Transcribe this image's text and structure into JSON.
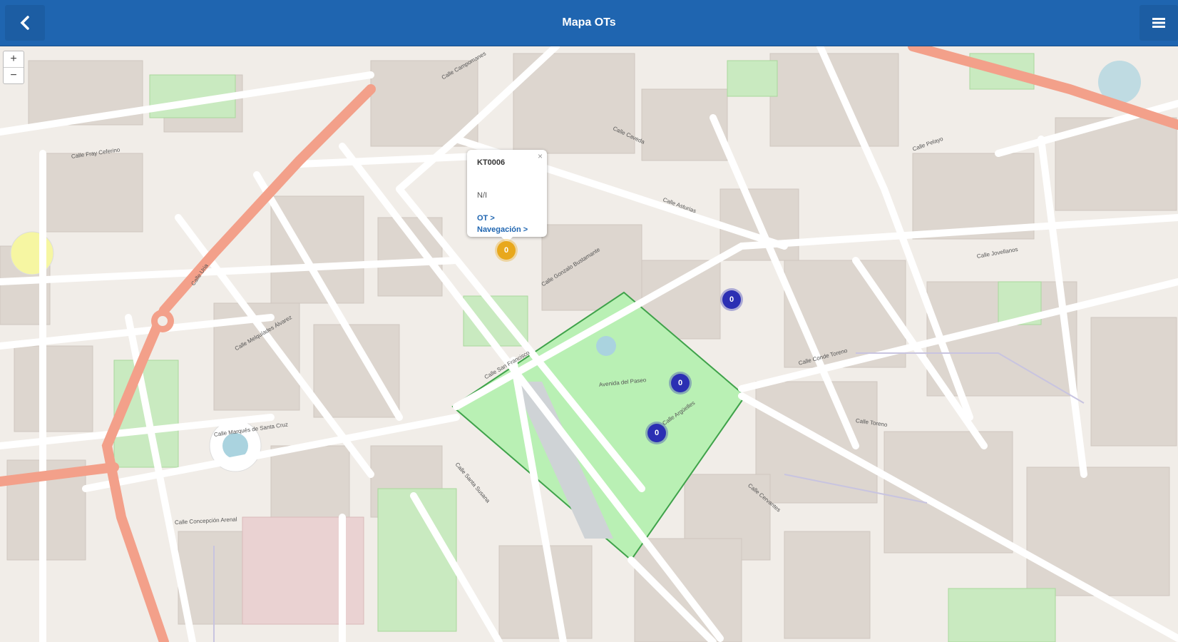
{
  "header": {
    "title": "Mapa OTs",
    "back_icon": "chevron-left-icon",
    "menu_icon": "hamburger-menu-icon",
    "background": "#1f65b0"
  },
  "map": {
    "zoom_in": "+",
    "zoom_out": "−",
    "popup": {
      "code": "KT0006",
      "close": "×",
      "status": "N/I",
      "link_ot": "OT >",
      "link_nav": "Navegación >"
    },
    "markers": [
      {
        "id": "ot-marker-1",
        "color": "orange",
        "text": "0"
      },
      {
        "id": "ot-marker-2",
        "color": "blue",
        "text": "0"
      },
      {
        "id": "ot-marker-3",
        "color": "blue",
        "text": "0"
      },
      {
        "id": "ot-marker-4",
        "color": "blue",
        "text": "0"
      }
    ],
    "street_labels": [
      "Calle Campomanes",
      "Calle Gonzalo Bustamante",
      "Calle Caveda",
      "Calle Fray Ceferino",
      "Calle Uria",
      "Calle Asturias",
      "Avenida del Paseo",
      "Calle Argüelles",
      "Calle Jovellanos",
      "Calle Santa Susana",
      "Calle Marqués de Santa Cruz",
      "Calle Conde Toreno",
      "Calle Toreno",
      "Calle Pelayo",
      "Calle Concepción Arenal",
      "Calle Cervantes",
      "Calle Melquíades Álvarez",
      "Calle San Francisco"
    ]
  }
}
